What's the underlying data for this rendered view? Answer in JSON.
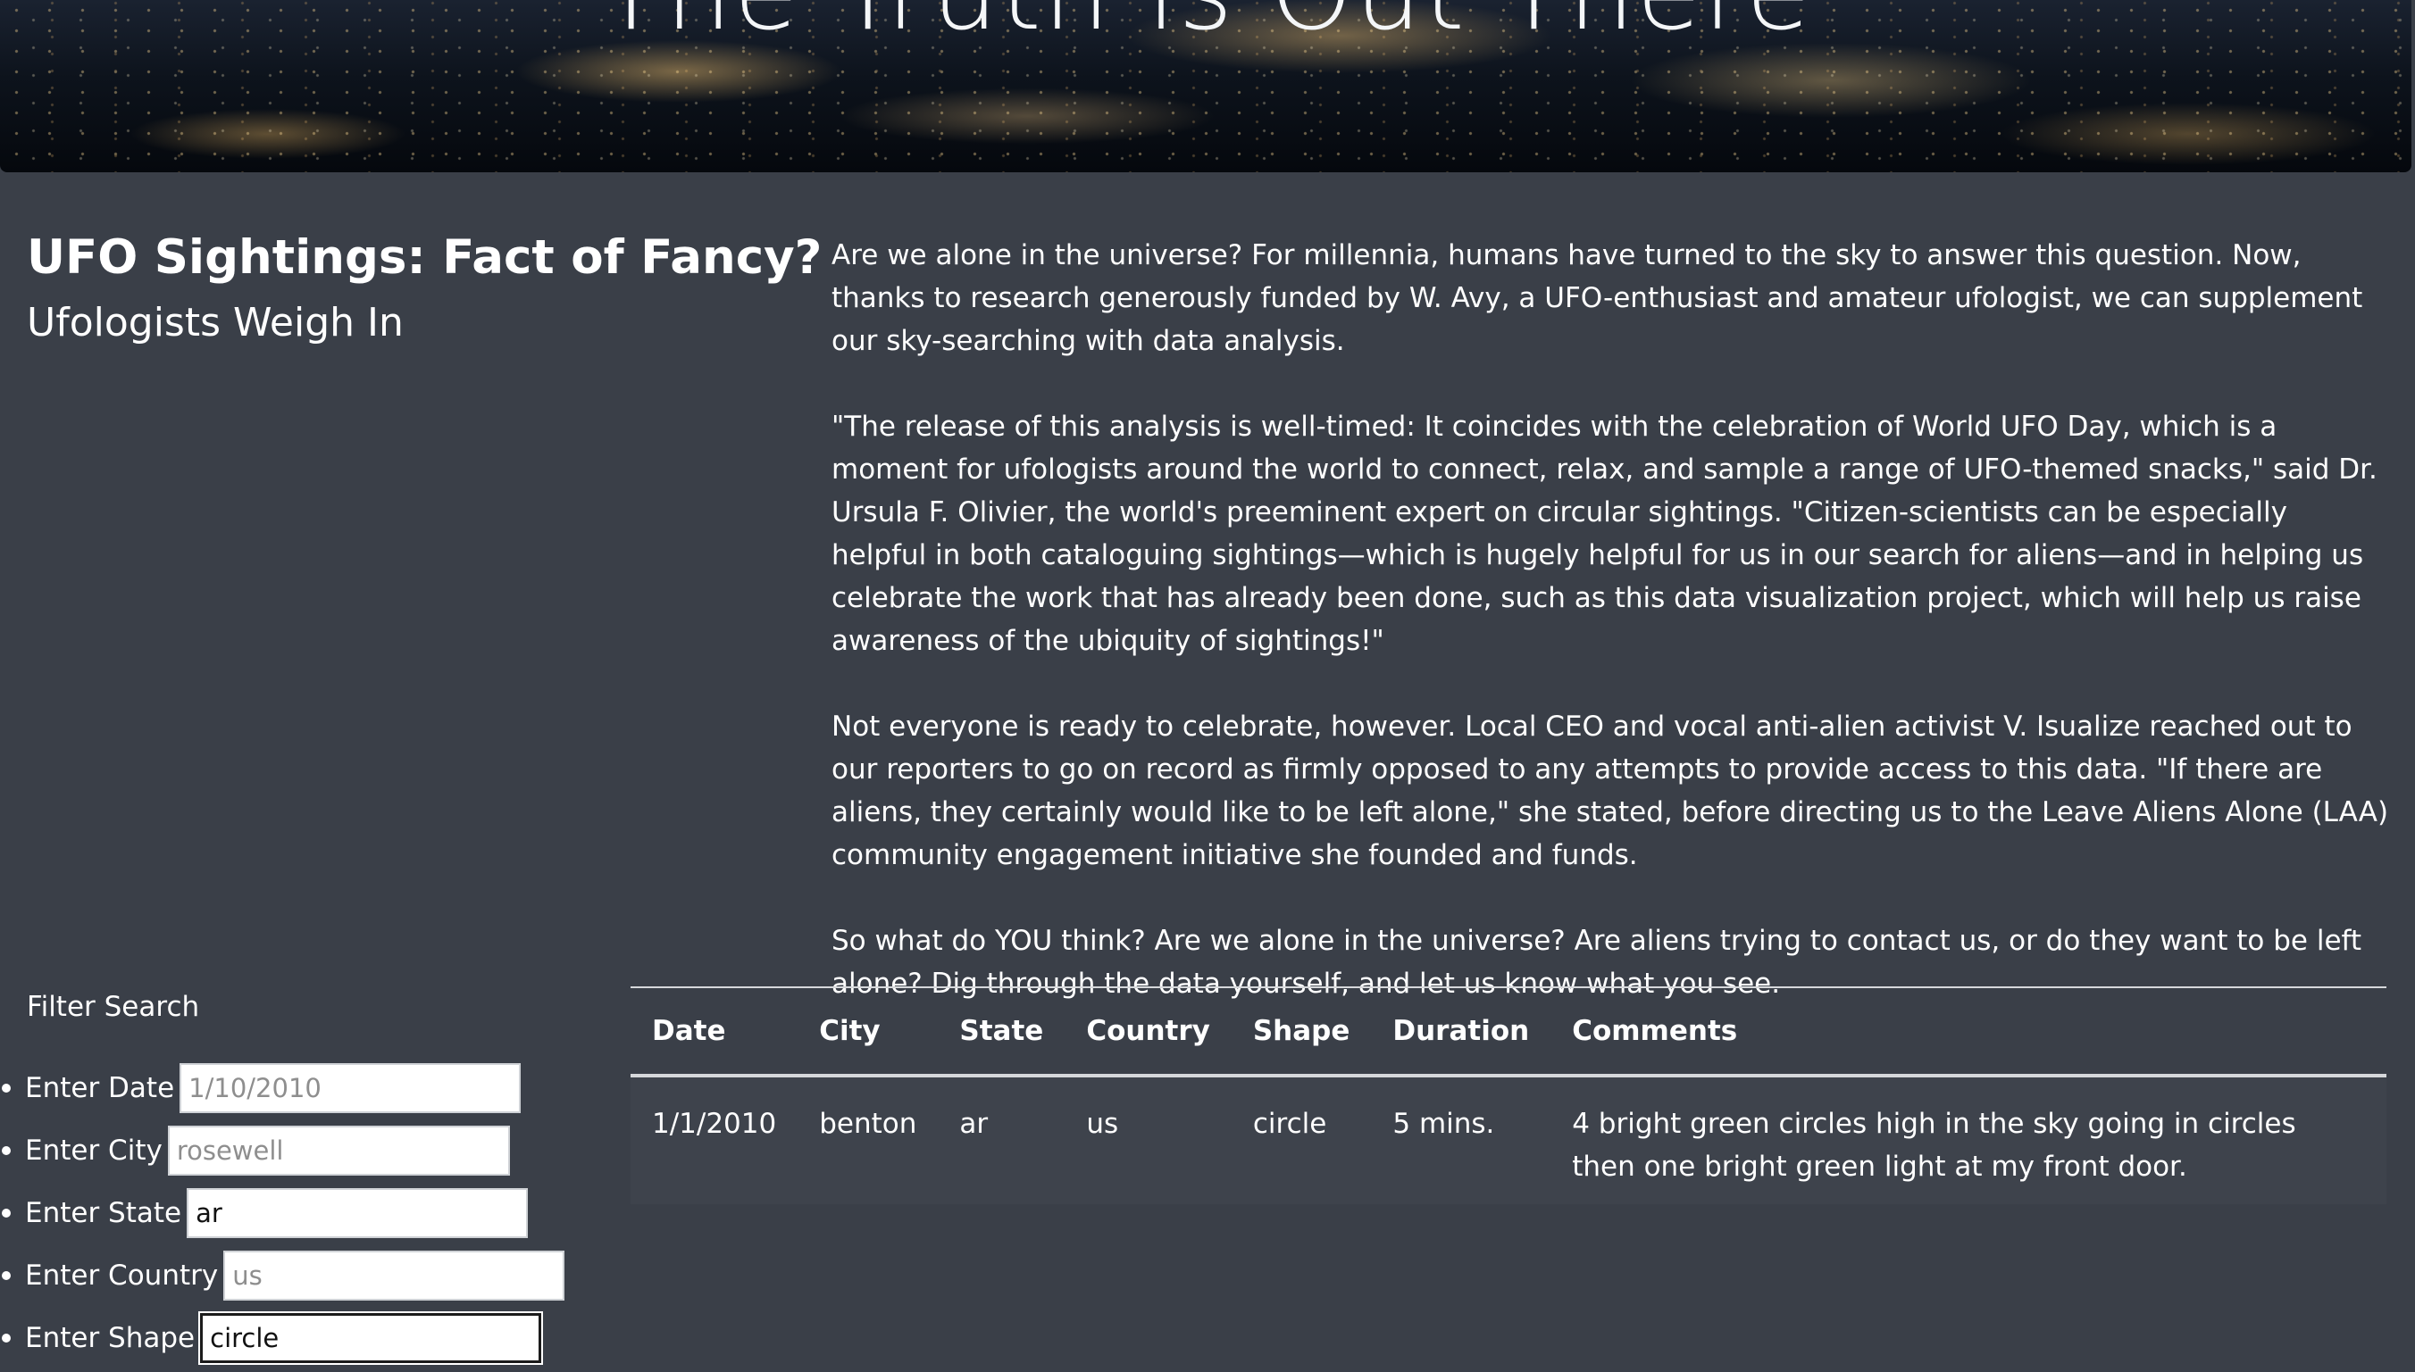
{
  "hero": {
    "title": "The Truth is Out There"
  },
  "header": {
    "title": "UFO Sightings: Fact of Fancy?",
    "subtitle": "Ufologists Weigh In"
  },
  "article": {
    "paragraphs": [
      "Are we alone in the universe? For millennia, humans have turned to the sky to answer this question. Now, thanks to research generously funded by W. Avy, a UFO-enthusiast and amateur ufologist, we can supplement our sky-searching with data analysis.",
      "\"The release of this analysis is well-timed: It coincides with the celebration of World UFO Day, which is a moment for ufologists around the world to connect, relax, and sample a range of UFO-themed snacks,\" said Dr. Ursula F. Olivier, the world's preeminent expert on circular sightings. \"Citizen-scientists can be especially helpful in both cataloguing sightings—which is hugely helpful for us in our search for aliens—and in helping us celebrate the work that has already been done, such as this data visualization project, which will help us raise awareness of the ubiquity of sightings!\"",
      "Not everyone is ready to celebrate, however. Local CEO and vocal anti-alien activist V. Isualize reached out to our reporters to go on record as firmly opposed to any attempts to provide access to this data. \"If there are aliens, they certainly would like to be left alone,\" she stated, before directing us to the Leave Aliens Alone (LAA) community engagement initiative she founded and funds.",
      "So what do YOU think? Are we alone in the universe? Are aliens trying to contact us, or do they want to be left alone? Dig through the data yourself, and let us know what you see."
    ]
  },
  "filter": {
    "title": "Filter Search",
    "items": [
      {
        "label": "Enter Date",
        "value": "",
        "placeholder": "1/10/2010"
      },
      {
        "label": "Enter City",
        "value": "",
        "placeholder": "rosewell"
      },
      {
        "label": "Enter State",
        "value": "ar",
        "placeholder": ""
      },
      {
        "label": "Enter Country",
        "value": "",
        "placeholder": "us"
      },
      {
        "label": "Enter Shape",
        "value": "circle",
        "placeholder": ""
      }
    ]
  },
  "table": {
    "headers": [
      "Date",
      "City",
      "State",
      "Country",
      "Shape",
      "Duration",
      "Comments"
    ],
    "rows": [
      [
        "1/1/2010",
        "benton",
        "ar",
        "us",
        "circle",
        "5 mins.",
        "4 bright green circles high in the sky going in circles then one bright green light at my front door."
      ]
    ]
  }
}
